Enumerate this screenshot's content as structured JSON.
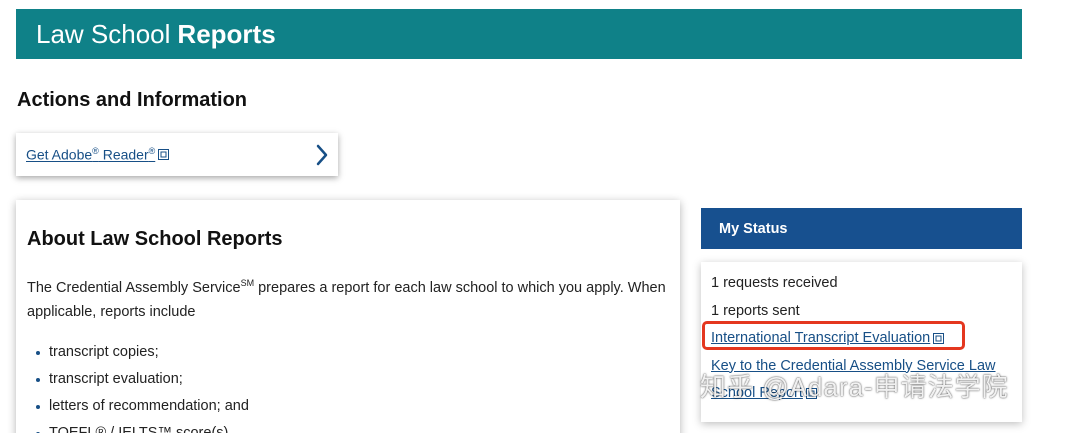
{
  "header": {
    "title_regular": "Law School",
    "title_bold": "Reports"
  },
  "actions": {
    "heading": "Actions and Information",
    "adobe_link_parts": [
      "Get Adobe",
      "®",
      " Reader",
      "®"
    ]
  },
  "about": {
    "heading": "About Law School Reports",
    "paragraph_parts": [
      "The Credential Assembly Service",
      "SM",
      " prepares a report for each law school to which you apply. When applicable, reports include"
    ],
    "bullets": [
      "transcript copies;",
      "transcript evaluation;",
      "letters of recommendation; and",
      "TOEFL® / IELTS™ score(s)"
    ]
  },
  "status": {
    "heading": "My Status",
    "requests_received": "1 requests received",
    "reports_sent": "1 reports sent",
    "links": [
      "International Transcript Evaluation",
      "Key to the Credential Assembly Service Law School Report"
    ]
  },
  "watermark": "知乎 @Adara-申请法学院",
  "colors": {
    "banner": "#0f8188",
    "status_header": "#17508f",
    "link": "#174f86",
    "highlight": "#e4371f"
  },
  "icons": {
    "external_link": "external-link-icon",
    "chevron": "chevron-right-icon"
  }
}
